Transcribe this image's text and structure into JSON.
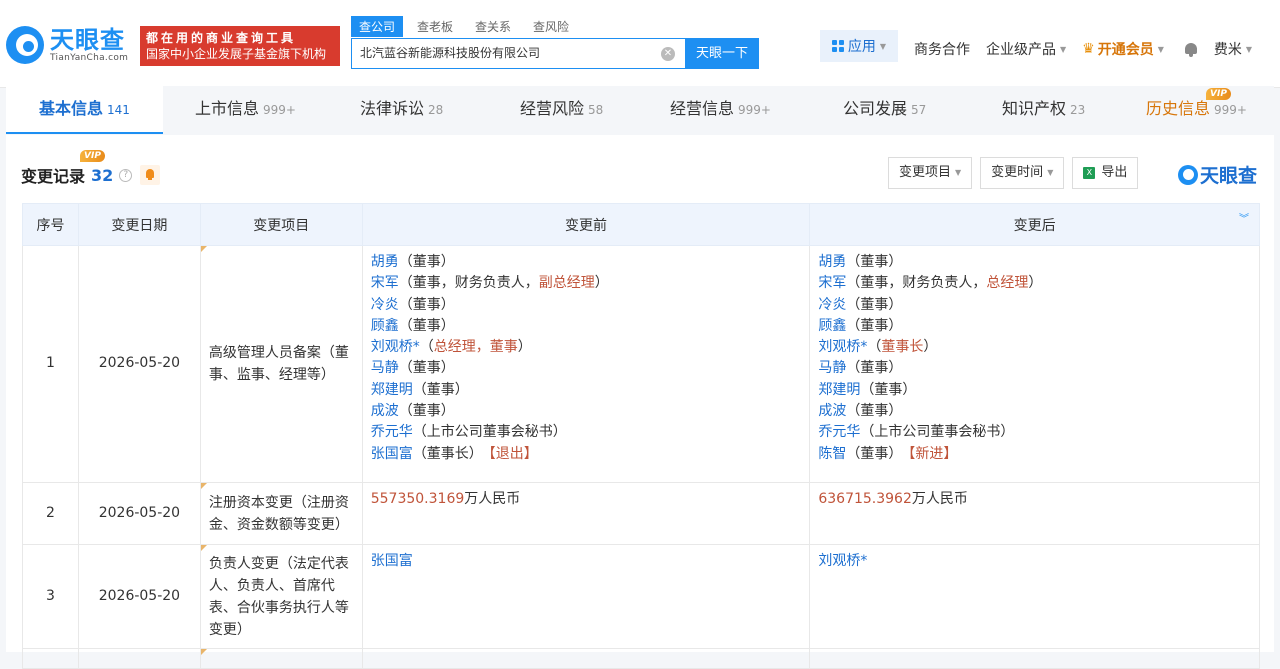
{
  "header": {
    "logo_cn": "天眼查",
    "logo_en": "TianYanCha.com",
    "promo_line1": "都在用的商业查询工具",
    "promo_line2": "国家中小企业发展子基金旗下机构",
    "search_tabs": [
      "查公司",
      "查老板",
      "查关系",
      "查风险"
    ],
    "search_value": "北汽蓝谷新能源科技股份有限公司",
    "search_button": "天眼一下",
    "apps_label": "应用",
    "biz_coop": "商务合作",
    "enterprise_products": "企业级产品",
    "vip_label": "开通会员",
    "user_name": "费米"
  },
  "tabs": [
    {
      "label": "基本信息",
      "count": "141"
    },
    {
      "label": "上市信息",
      "count": "999+"
    },
    {
      "label": "法律诉讼",
      "count": "28"
    },
    {
      "label": "经营风险",
      "count": "58"
    },
    {
      "label": "经营信息",
      "count": "999+"
    },
    {
      "label": "公司发展",
      "count": "57"
    },
    {
      "label": "知识产权",
      "count": "23"
    },
    {
      "label": "历史信息",
      "count": "999+"
    }
  ],
  "vip_tag": "VIP",
  "section": {
    "title": "变更记录",
    "count": "32",
    "help": "?",
    "filter_item": "变更项目",
    "filter_time": "变更时间",
    "export": "导出",
    "brand": "天眼查"
  },
  "table": {
    "headers": [
      "序号",
      "变更日期",
      "变更项目",
      "变更前",
      "变更后"
    ],
    "rows": [
      {
        "no": "1",
        "date": "2026-05-20",
        "item": "高级管理人员备案（董事、监事、经理等）",
        "before": [
          {
            "name": "胡勇",
            "pre": "（董事）",
            "hl": "",
            "post": "",
            "tag": ""
          },
          {
            "name": "宋军",
            "pre": "（董事，财务负责人，",
            "hl": "副总经理",
            "post": "）",
            "tag": ""
          },
          {
            "name": "冷炎",
            "pre": "（董事）",
            "hl": "",
            "post": "",
            "tag": ""
          },
          {
            "name": "顾鑫",
            "pre": "（董事）",
            "hl": "",
            "post": "",
            "tag": ""
          },
          {
            "name": "刘观桥*",
            "pre": "（",
            "hl": "总经理，董事",
            "post": "）",
            "tag": ""
          },
          {
            "name": "马静",
            "pre": "（董事）",
            "hl": "",
            "post": "",
            "tag": ""
          },
          {
            "name": "郑建明",
            "pre": "（董事）",
            "hl": "",
            "post": "",
            "tag": ""
          },
          {
            "name": "成波",
            "pre": "（董事）",
            "hl": "",
            "post": "",
            "tag": ""
          },
          {
            "name": "乔元华",
            "pre": "（上市公司董事会秘书）",
            "hl": "",
            "post": "",
            "tag": ""
          },
          {
            "name": "张国富",
            "pre": "（董事长）",
            "hl": "",
            "post": "",
            "tag": "【退出】"
          }
        ],
        "after": [
          {
            "name": "胡勇",
            "pre": "（董事）",
            "hl": "",
            "post": "",
            "tag": ""
          },
          {
            "name": "宋军",
            "pre": "（董事，财务负责人，",
            "hl": "总经理",
            "post": "）",
            "tag": ""
          },
          {
            "name": "冷炎",
            "pre": "（董事）",
            "hl": "",
            "post": "",
            "tag": ""
          },
          {
            "name": "顾鑫",
            "pre": "（董事）",
            "hl": "",
            "post": "",
            "tag": ""
          },
          {
            "name": "刘观桥*",
            "pre": "（",
            "hl": "董事长",
            "post": "）",
            "tag": ""
          },
          {
            "name": "马静",
            "pre": "（董事）",
            "hl": "",
            "post": "",
            "tag": ""
          },
          {
            "name": "郑建明",
            "pre": "（董事）",
            "hl": "",
            "post": "",
            "tag": ""
          },
          {
            "name": "成波",
            "pre": "（董事）",
            "hl": "",
            "post": "",
            "tag": ""
          },
          {
            "name": "乔元华",
            "pre": "（上市公司董事会秘书）",
            "hl": "",
            "post": "",
            "tag": ""
          },
          {
            "name": "陈智",
            "pre": "（董事）",
            "hl": "",
            "post": "",
            "tag": "【新进】"
          }
        ]
      },
      {
        "no": "2",
        "date": "2026-05-20",
        "item": "注册资本变更（注册资金、资金数额等变更）",
        "before_amount": "557350.3169",
        "before_unit": "万人民币",
        "after_amount": "636715.3962",
        "after_unit": "万人民币"
      },
      {
        "no": "3",
        "date": "2026-05-20",
        "item": "负责人变更（法定代表人、负责人、首席代表、合伙事务执行人等变更）",
        "before_name": "张国富",
        "after_name": "刘观桥*"
      }
    ]
  }
}
